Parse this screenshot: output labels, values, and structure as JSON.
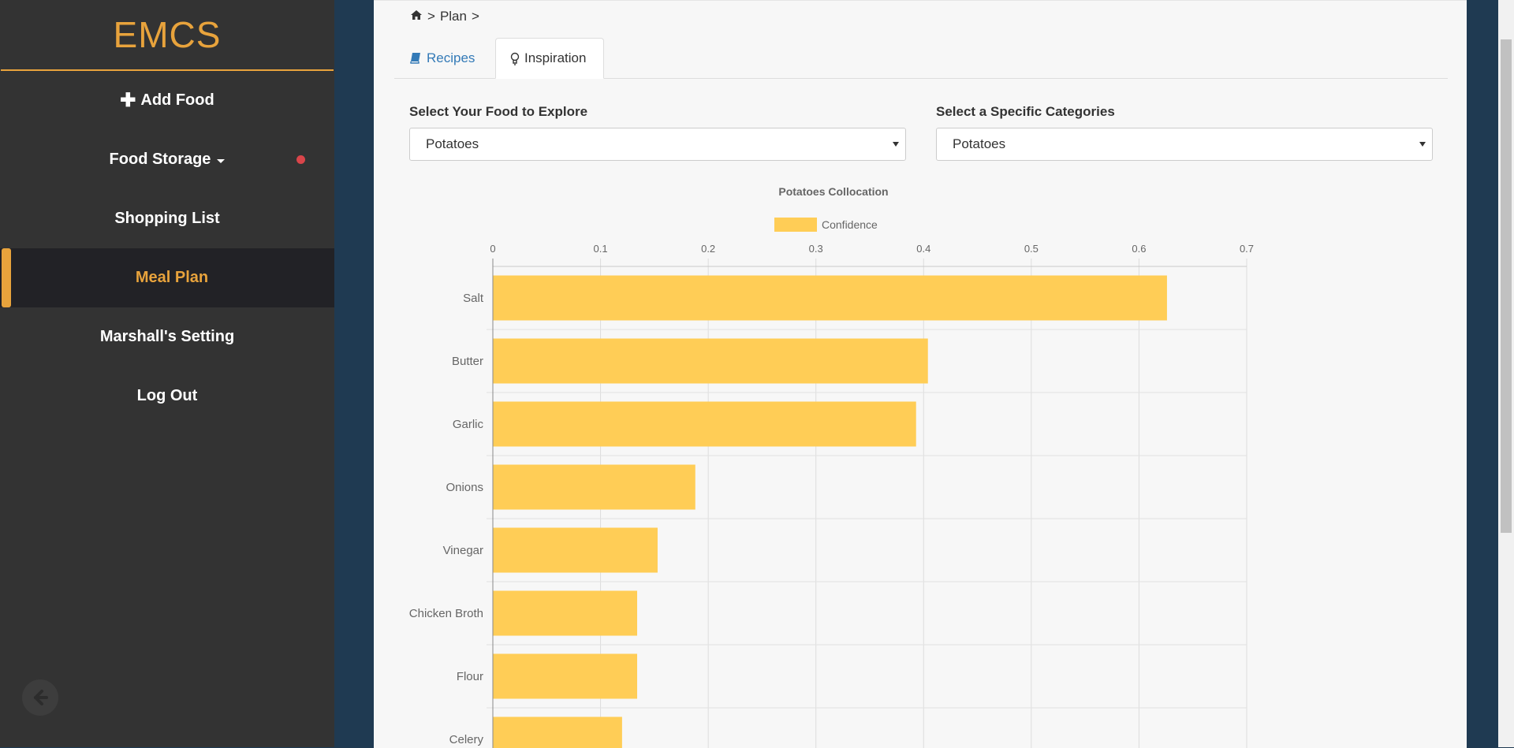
{
  "sidebar": {
    "brand": "EMCS",
    "items": [
      {
        "label": "Add Food",
        "icon": "plus-icon"
      },
      {
        "label": "Food Storage",
        "icon": "caret-down-icon",
        "badge_color": "#d9454a"
      },
      {
        "label": "Shopping List"
      },
      {
        "label": "Meal Plan",
        "active": true
      },
      {
        "label": "Marshall's Setting"
      },
      {
        "label": "Log Out"
      }
    ],
    "back_icon": "arrow-left-circle-icon"
  },
  "breadcrumb": {
    "home_icon": "home-icon",
    "sep": ">",
    "plan": "Plan",
    "trailing": ">"
  },
  "tabs": [
    {
      "label": "Recipes",
      "icon": "book-icon"
    },
    {
      "label": "Inspiration",
      "icon": "lightbulb-icon",
      "active": true
    }
  ],
  "filters": {
    "food": {
      "label": "Select Your Food to Explore",
      "value": "Potatoes"
    },
    "category": {
      "label": "Select a Specific Categories",
      "value": "Potatoes"
    }
  },
  "colors": {
    "accent": "#e8a33c",
    "bar": "#ffcd56",
    "link": "#337ab7"
  },
  "chart_data": {
    "type": "bar",
    "orientation": "horizontal",
    "title": "Potatoes Collocation",
    "legend": "top",
    "categories": [
      "Salt",
      "Butter",
      "Garlic",
      "Onions",
      "Vinegar",
      "Chicken Broth",
      "Flour",
      "Celery"
    ],
    "series": [
      {
        "name": "Confidence",
        "values": [
          0.626,
          0.404,
          0.393,
          0.188,
          0.153,
          0.134,
          0.134,
          0.12
        ]
      }
    ],
    "xlim": [
      0,
      0.7
    ],
    "xticks": [
      "0",
      "0.1",
      "0.2",
      "0.3",
      "0.4",
      "0.5",
      "0.6",
      "0.7"
    ],
    "grid": true
  }
}
